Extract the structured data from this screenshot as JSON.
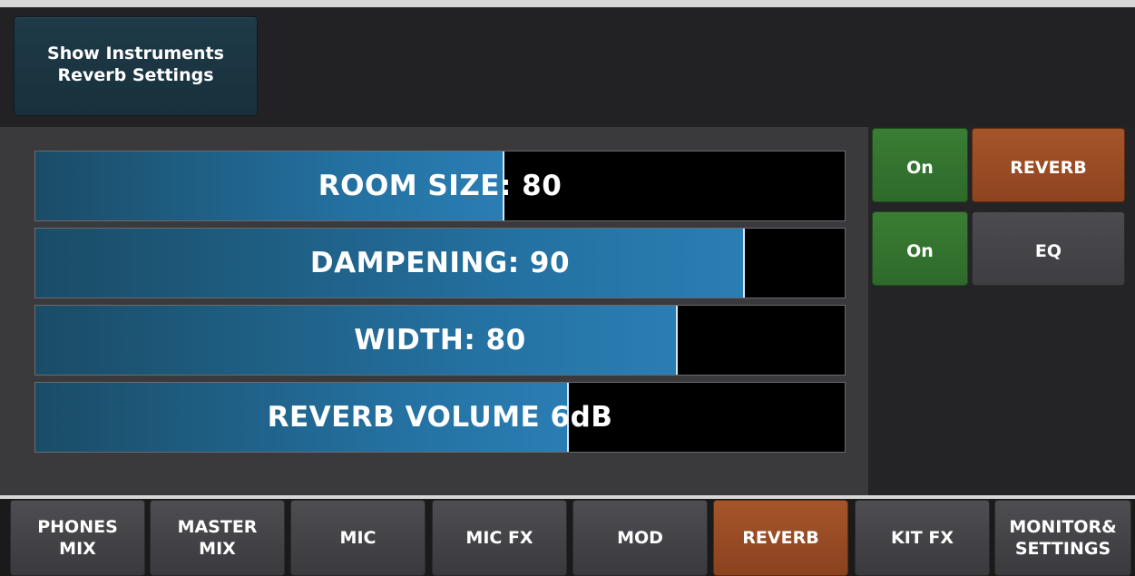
{
  "header": {
    "show_button_line1": "Show Instruments",
    "show_button_line2": "Reverb Settings"
  },
  "sliders": [
    {
      "label": "ROOM SIZE: 80",
      "value_fraction": 0.58
    },
    {
      "label": "DAMPENING: 90",
      "value_fraction": 0.877
    },
    {
      "label": "WIDTH: 80",
      "value_fraction": 0.794
    },
    {
      "label": "REVERB VOLUME 6dB",
      "value_fraction": 0.659
    }
  ],
  "effects": [
    {
      "toggle": "On",
      "name": "REVERB",
      "active": true
    },
    {
      "toggle": "On",
      "name": "EQ",
      "active": false
    }
  ],
  "tabs": [
    {
      "line1": "PHONES",
      "line2": "MIX",
      "active": false
    },
    {
      "line1": "MASTER",
      "line2": "MIX",
      "active": false
    },
    {
      "line1": "MIC",
      "line2": "",
      "active": false
    },
    {
      "line1": "MIC FX",
      "line2": "",
      "active": false
    },
    {
      "line1": "MOD",
      "line2": "",
      "active": false
    },
    {
      "line1": "REVERB",
      "line2": "",
      "active": true
    },
    {
      "line1": "KIT FX",
      "line2": "",
      "active": false
    },
    {
      "line1": "MONITOR&",
      "line2": "SETTINGS",
      "active": false
    }
  ],
  "colors": {
    "accent_orange": "#a6552a",
    "toggle_green": "#3a7d34",
    "slider_blue": "#2472a3"
  }
}
